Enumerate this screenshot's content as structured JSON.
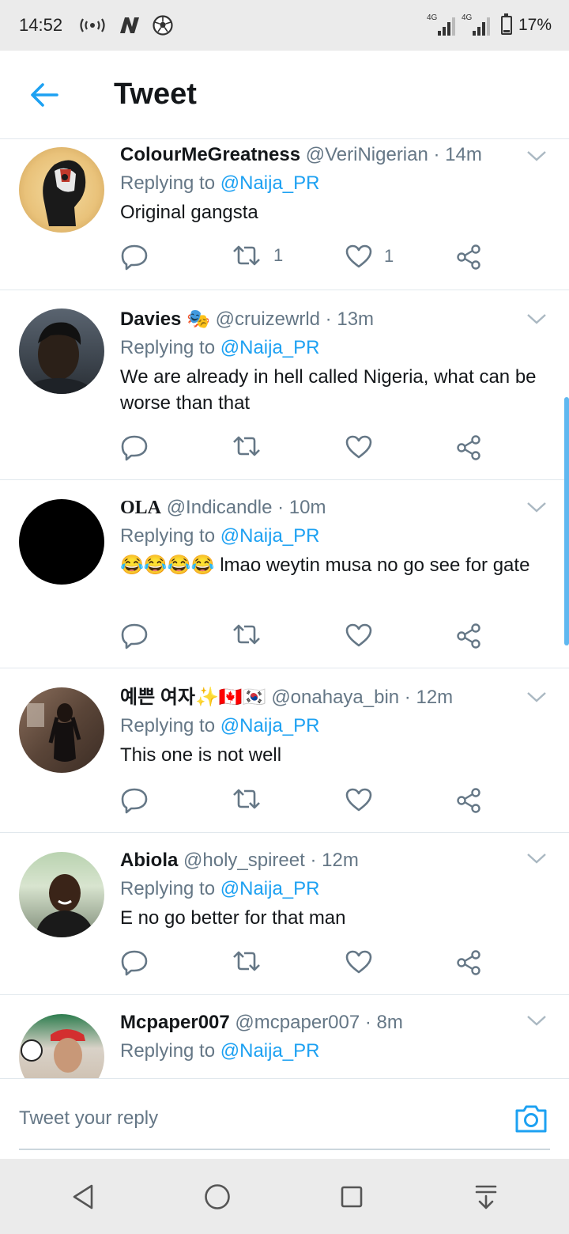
{
  "status_bar": {
    "time": "14:52",
    "network_label_1": "4G",
    "network_label_2": "4G",
    "battery": "17%"
  },
  "header": {
    "title": "Tweet"
  },
  "tweets": [
    {
      "name": "ColourMeGreatness",
      "handle": "@VeriNigerian",
      "time": "14m",
      "reply_prefix": "Replying to ",
      "reply_to": "@Naija_PR",
      "text": "Original gangsta",
      "retweets": "1",
      "likes": "1"
    },
    {
      "name": "Davies",
      "name_emoji": "🎭",
      "handle": "@cruizewrld",
      "time": "13m",
      "reply_prefix": "Replying to ",
      "reply_to": "@Naija_PR",
      "text": "We are already in hell called Nigeria, what can be worse than that",
      "retweets": "",
      "likes": ""
    },
    {
      "name": "OLA",
      "handle": "@Indicandle",
      "time": "10m",
      "reply_prefix": "Replying to ",
      "reply_to": "@Naija_PR",
      "text": "😂😂😂😂 lmao weytin musa no go see for gate",
      "retweets": "",
      "likes": ""
    },
    {
      "name": "예쁜 여자✨🇨🇦🇰🇷",
      "handle": "@onahaya_bin",
      "time": "12m",
      "reply_prefix": "Replying to ",
      "reply_to": "@Naija_PR",
      "text": "This one is not well",
      "retweets": "",
      "likes": ""
    },
    {
      "name": "Abiola",
      "handle": "@holy_spireet",
      "time": "12m",
      "reply_prefix": "Replying to ",
      "reply_to": "@Naija_PR",
      "text": "E no go better for that man",
      "retweets": "",
      "likes": ""
    },
    {
      "name": "Mcpaper007",
      "handle": "@mcpaper007",
      "time": "8m",
      "reply_prefix": "Replying to ",
      "reply_to": "@Naija_PR",
      "text": "",
      "retweets": "",
      "likes": ""
    }
  ],
  "composer": {
    "placeholder": "Tweet your reply"
  },
  "colors": {
    "accent": "#1da1f2",
    "muted": "#657786",
    "text": "#14171a",
    "divider": "#e1e8ed"
  }
}
